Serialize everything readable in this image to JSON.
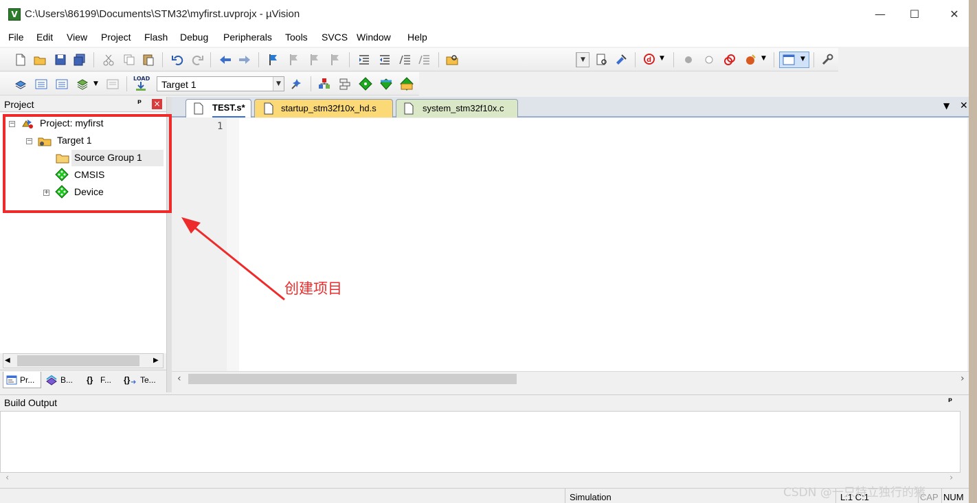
{
  "window": {
    "title": "C:\\Users\\86199\\Documents\\STM32\\myfirst.uvprojx - µVision",
    "app_icon": "V",
    "minimize": "—",
    "maximize": "☐",
    "close": "✕"
  },
  "menu": [
    {
      "label": "File"
    },
    {
      "label": "Edit"
    },
    {
      "label": "View"
    },
    {
      "label": "Project"
    },
    {
      "label": "Flash"
    },
    {
      "label": "Debug"
    },
    {
      "label": "Peripherals"
    },
    {
      "label": "Tools"
    },
    {
      "label": "SVCS"
    },
    {
      "label": "Window"
    },
    {
      "label": "Help"
    }
  ],
  "toolbar2": {
    "load_label": "LOAD",
    "target_select": "Target 1"
  },
  "project_panel": {
    "title": "Project",
    "pin": "ᵖ",
    "close": "×",
    "tree": {
      "root": "Project: myfirst",
      "target": "Target 1",
      "group": "Source Group 1",
      "cmsis": "CMSIS",
      "device": "Device"
    },
    "tabs": [
      "Pr...",
      "B...",
      "F...",
      "Te..."
    ],
    "tab_glyphs": [
      "{}",
      "{}"
    ]
  },
  "editor": {
    "tabs": [
      {
        "label": "TEST.s*",
        "active": true
      },
      {
        "label": "startup_stm32f10x_hd.s",
        "active": false
      },
      {
        "label": "system_stm32f10x.c",
        "active": false
      }
    ],
    "line_numbers": [
      "1"
    ],
    "tab_menu": "▼",
    "tab_close": "✕"
  },
  "build_output": {
    "title": "Build Output",
    "pin": "ᵖ"
  },
  "status": {
    "mode": "Simulation",
    "cursor": "L:1 C:1",
    "caps": "CAP",
    "num": "NUM"
  },
  "annotation": "创建项目",
  "watermark": "CSDN @一只特立独行的猪",
  "colors": {
    "highlight": "#ee2b2b",
    "active_tab": "#ffffff",
    "startup_tab": "#fbd977",
    "system_tab": "#dbe8c8"
  }
}
